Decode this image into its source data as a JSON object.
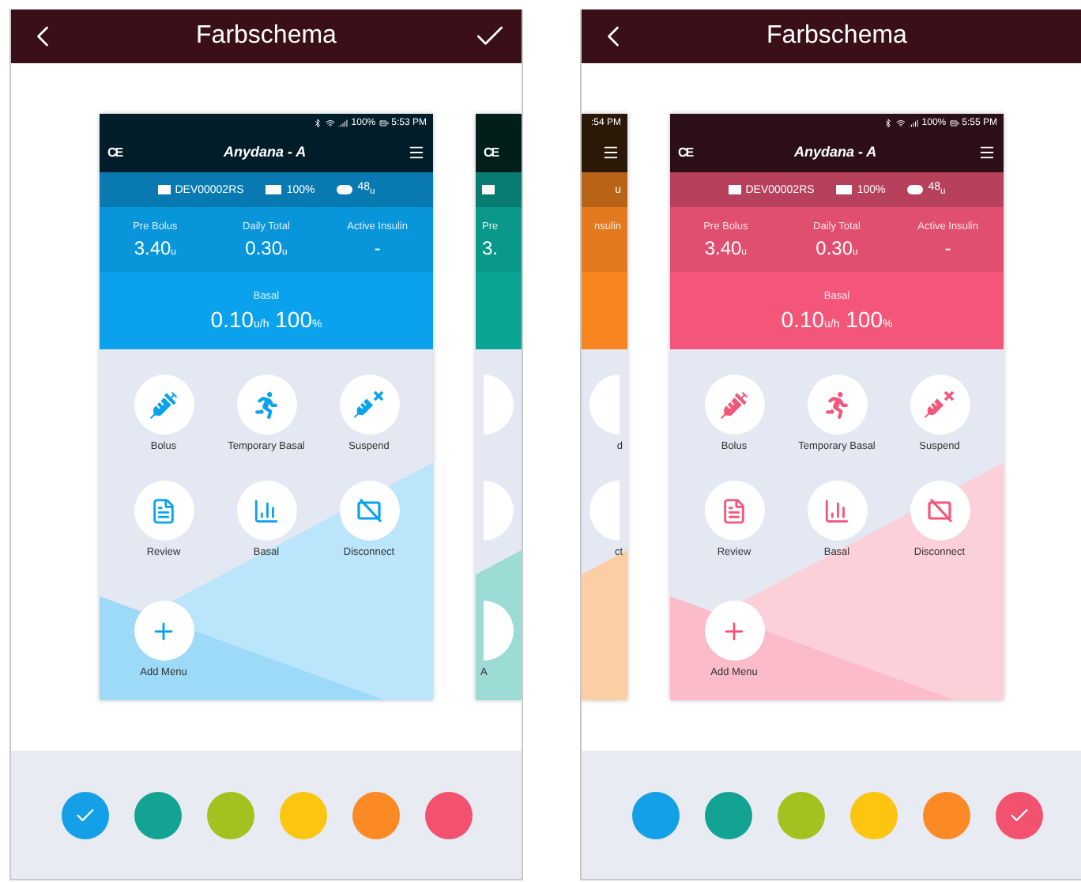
{
  "screens": [
    {
      "title": "Farbschema",
      "confirm": true,
      "previews": [
        {
          "kind": "full",
          "color": "#0aa2ec",
          "status_battery": "100%",
          "status_time": "5:53 PM",
          "ce_mark": "CE",
          "logo": "Anydana - A",
          "device": "DEV00002RS",
          "device_battery": "100%",
          "reservoir": "48$_{u}$",
          "stats": [
            {
              "label": "Pre Bolus",
              "value": "3.40$_{u}$"
            },
            {
              "label": "Daily Total",
              "value": "0.30$_{u}$"
            },
            {
              "label": "Active Insulin",
              "value": "-"
            }
          ],
          "basal_label": "Basal",
          "basal_value": "0.10$_{u/h}$ 100$_{%}$",
          "menu": [
            {
              "label": "Bolus"
            },
            {
              "label": "Temporary Basal"
            },
            {
              "label": "Suspend"
            },
            {
              "label": "Review"
            },
            {
              "label": "Basal"
            },
            {
              "label": "Disconnect"
            },
            {
              "label": "Add Menu"
            }
          ]
        },
        {
          "kind": "partial",
          "color": "#0ba596",
          "ce_mark": "CE",
          "device_icon": true,
          "stat_label": "Pre",
          "stat_value": "3.",
          "rows": [
            {
              "circle": true
            },
            {
              "circle": true
            },
            {
              "circle": true,
              "label": "A"
            }
          ]
        }
      ],
      "swatches": [
        {
          "color": "#14a0e6",
          "selected": true
        },
        {
          "color": "#13a393",
          "selected": false
        },
        {
          "color": "#a4c21f",
          "selected": false
        },
        {
          "color": "#fcc50f",
          "selected": false
        },
        {
          "color": "#fb8a25",
          "selected": false
        },
        {
          "color": "#f2516f",
          "selected": false
        }
      ]
    },
    {
      "title": "Farbschema",
      "confirm": false,
      "previews": [
        {
          "kind": "partial",
          "color": "#f7841f",
          "status_time": ":54 PM",
          "device_text": "u",
          "stat_label": "nsulin",
          "rows": [
            {
              "circle": true,
              "label": "d"
            },
            {
              "circle": true,
              "label": "ct"
            },
            {
              "circle": false
            }
          ]
        },
        {
          "kind": "full",
          "color": "#f45679",
          "status_battery": "100%",
          "status_time": "5:55 PM",
          "ce_mark": "CE",
          "logo": "Anydana - A",
          "device": "DEV00002RS",
          "device_battery": "100%",
          "reservoir": "48$_{u}$",
          "stats": [
            {
              "label": "Pre Bolus",
              "value": "3.40$_{u}$"
            },
            {
              "label": "Daily Total",
              "value": "0.30$_{u}$"
            },
            {
              "label": "Active Insulin",
              "value": "-"
            }
          ],
          "basal_label": "Basal",
          "basal_value": "0.10$_{u/h}$ 100$_{%}$",
          "menu": [
            {
              "label": "Bolus"
            },
            {
              "label": "Temporary Basal"
            },
            {
              "label": "Suspend"
            },
            {
              "label": "Review"
            },
            {
              "label": "Basal"
            },
            {
              "label": "Disconnect"
            },
            {
              "label": "Add Menu"
            }
          ]
        }
      ],
      "swatches": [
        {
          "color": "#14a0e6",
          "selected": false
        },
        {
          "color": "#13a393",
          "selected": false
        },
        {
          "color": "#a4c21f",
          "selected": false
        },
        {
          "color": "#fcc50f",
          "selected": false
        },
        {
          "color": "#fb8a25",
          "selected": false
        },
        {
          "color": "#f2516f",
          "selected": true
        }
      ]
    }
  ]
}
